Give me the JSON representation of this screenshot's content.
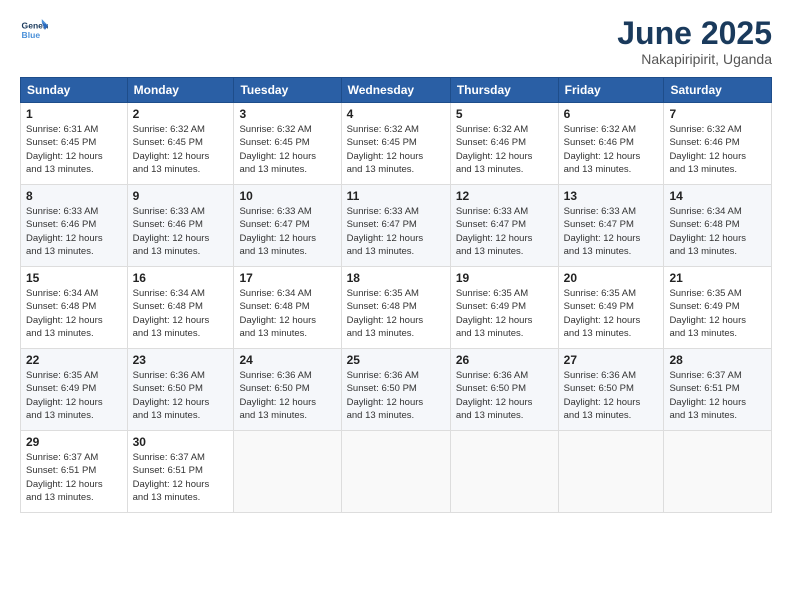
{
  "logo": {
    "line1": "General",
    "line2": "Blue"
  },
  "title": "June 2025",
  "location": "Nakapiripirit, Uganda",
  "weekdays": [
    "Sunday",
    "Monday",
    "Tuesday",
    "Wednesday",
    "Thursday",
    "Friday",
    "Saturday"
  ],
  "weeks": [
    [
      {
        "day": "1",
        "info": "Sunrise: 6:31 AM\nSunset: 6:45 PM\nDaylight: 12 hours\nand 13 minutes."
      },
      {
        "day": "2",
        "info": "Sunrise: 6:32 AM\nSunset: 6:45 PM\nDaylight: 12 hours\nand 13 minutes."
      },
      {
        "day": "3",
        "info": "Sunrise: 6:32 AM\nSunset: 6:45 PM\nDaylight: 12 hours\nand 13 minutes."
      },
      {
        "day": "4",
        "info": "Sunrise: 6:32 AM\nSunset: 6:45 PM\nDaylight: 12 hours\nand 13 minutes."
      },
      {
        "day": "5",
        "info": "Sunrise: 6:32 AM\nSunset: 6:46 PM\nDaylight: 12 hours\nand 13 minutes."
      },
      {
        "day": "6",
        "info": "Sunrise: 6:32 AM\nSunset: 6:46 PM\nDaylight: 12 hours\nand 13 minutes."
      },
      {
        "day": "7",
        "info": "Sunrise: 6:32 AM\nSunset: 6:46 PM\nDaylight: 12 hours\nand 13 minutes."
      }
    ],
    [
      {
        "day": "8",
        "info": "Sunrise: 6:33 AM\nSunset: 6:46 PM\nDaylight: 12 hours\nand 13 minutes."
      },
      {
        "day": "9",
        "info": "Sunrise: 6:33 AM\nSunset: 6:46 PM\nDaylight: 12 hours\nand 13 minutes."
      },
      {
        "day": "10",
        "info": "Sunrise: 6:33 AM\nSunset: 6:47 PM\nDaylight: 12 hours\nand 13 minutes."
      },
      {
        "day": "11",
        "info": "Sunrise: 6:33 AM\nSunset: 6:47 PM\nDaylight: 12 hours\nand 13 minutes."
      },
      {
        "day": "12",
        "info": "Sunrise: 6:33 AM\nSunset: 6:47 PM\nDaylight: 12 hours\nand 13 minutes."
      },
      {
        "day": "13",
        "info": "Sunrise: 6:33 AM\nSunset: 6:47 PM\nDaylight: 12 hours\nand 13 minutes."
      },
      {
        "day": "14",
        "info": "Sunrise: 6:34 AM\nSunset: 6:48 PM\nDaylight: 12 hours\nand 13 minutes."
      }
    ],
    [
      {
        "day": "15",
        "info": "Sunrise: 6:34 AM\nSunset: 6:48 PM\nDaylight: 12 hours\nand 13 minutes."
      },
      {
        "day": "16",
        "info": "Sunrise: 6:34 AM\nSunset: 6:48 PM\nDaylight: 12 hours\nand 13 minutes."
      },
      {
        "day": "17",
        "info": "Sunrise: 6:34 AM\nSunset: 6:48 PM\nDaylight: 12 hours\nand 13 minutes."
      },
      {
        "day": "18",
        "info": "Sunrise: 6:35 AM\nSunset: 6:48 PM\nDaylight: 12 hours\nand 13 minutes."
      },
      {
        "day": "19",
        "info": "Sunrise: 6:35 AM\nSunset: 6:49 PM\nDaylight: 12 hours\nand 13 minutes."
      },
      {
        "day": "20",
        "info": "Sunrise: 6:35 AM\nSunset: 6:49 PM\nDaylight: 12 hours\nand 13 minutes."
      },
      {
        "day": "21",
        "info": "Sunrise: 6:35 AM\nSunset: 6:49 PM\nDaylight: 12 hours\nand 13 minutes."
      }
    ],
    [
      {
        "day": "22",
        "info": "Sunrise: 6:35 AM\nSunset: 6:49 PM\nDaylight: 12 hours\nand 13 minutes."
      },
      {
        "day": "23",
        "info": "Sunrise: 6:36 AM\nSunset: 6:50 PM\nDaylight: 12 hours\nand 13 minutes."
      },
      {
        "day": "24",
        "info": "Sunrise: 6:36 AM\nSunset: 6:50 PM\nDaylight: 12 hours\nand 13 minutes."
      },
      {
        "day": "25",
        "info": "Sunrise: 6:36 AM\nSunset: 6:50 PM\nDaylight: 12 hours\nand 13 minutes."
      },
      {
        "day": "26",
        "info": "Sunrise: 6:36 AM\nSunset: 6:50 PM\nDaylight: 12 hours\nand 13 minutes."
      },
      {
        "day": "27",
        "info": "Sunrise: 6:36 AM\nSunset: 6:50 PM\nDaylight: 12 hours\nand 13 minutes."
      },
      {
        "day": "28",
        "info": "Sunrise: 6:37 AM\nSunset: 6:51 PM\nDaylight: 12 hours\nand 13 minutes."
      }
    ],
    [
      {
        "day": "29",
        "info": "Sunrise: 6:37 AM\nSunset: 6:51 PM\nDaylight: 12 hours\nand 13 minutes."
      },
      {
        "day": "30",
        "info": "Sunrise: 6:37 AM\nSunset: 6:51 PM\nDaylight: 12 hours\nand 13 minutes."
      },
      {
        "day": "",
        "info": ""
      },
      {
        "day": "",
        "info": ""
      },
      {
        "day": "",
        "info": ""
      },
      {
        "day": "",
        "info": ""
      },
      {
        "day": "",
        "info": ""
      }
    ]
  ]
}
